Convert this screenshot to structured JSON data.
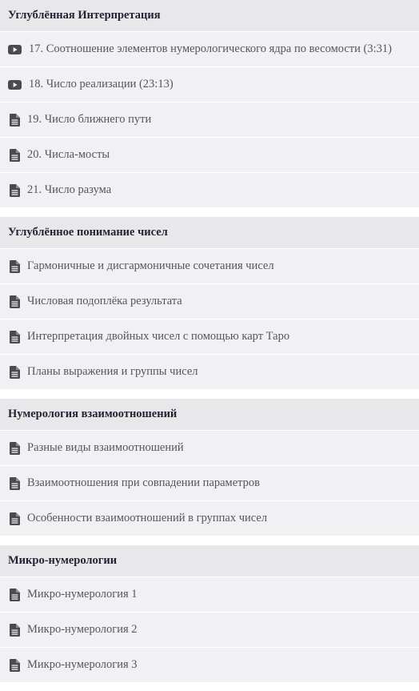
{
  "sections": [
    {
      "title": "Углублённая Интерпретация",
      "items": [
        {
          "type": "video",
          "icon": "play-video-icon",
          "label": "17. Соотношение элементов нумерологического ядра по весомости (3:31)"
        },
        {
          "type": "video",
          "icon": "play-video-icon",
          "label": "18. Число реализации (23:13)"
        },
        {
          "type": "doc",
          "icon": "document-icon",
          "label": "19. Число ближнего пути"
        },
        {
          "type": "doc",
          "icon": "document-icon",
          "label": "20. Числа-мосты"
        },
        {
          "type": "doc",
          "icon": "document-icon",
          "label": "21. Число разума"
        }
      ]
    },
    {
      "title": "Углублённое понимание чисел",
      "items": [
        {
          "type": "doc",
          "icon": "document-icon",
          "label": "Гармоничные и дисгармоничные сочетания чисел"
        },
        {
          "type": "doc",
          "icon": "document-icon",
          "label": "Числовая подоплёка результата"
        },
        {
          "type": "doc",
          "icon": "document-icon",
          "label": "Интерпретация двойных чисел с помощью карт Таро"
        },
        {
          "type": "doc",
          "icon": "document-icon",
          "label": "Планы выражения и группы чисел"
        }
      ]
    },
    {
      "title": "Нумерология взаимоотношений",
      "items": [
        {
          "type": "doc",
          "icon": "document-icon",
          "label": "Разные виды взаимоотношений"
        },
        {
          "type": "doc",
          "icon": "document-icon",
          "label": "Взаимоотношения при совпадении параметров"
        },
        {
          "type": "doc",
          "icon": "document-icon",
          "label": "Особенности взаимоотношений в группах чисел"
        }
      ]
    },
    {
      "title": "Микро-нумерологии",
      "items": [
        {
          "type": "doc",
          "icon": "document-icon",
          "label": "Микро-нумерология 1"
        },
        {
          "type": "doc",
          "icon": "document-icon",
          "label": "Микро-нумерология 2"
        },
        {
          "type": "doc",
          "icon": "document-icon",
          "label": "Микро-нумерология 3"
        }
      ]
    }
  ],
  "colors": {
    "section_header_bg": "#e8e8ea",
    "lesson_bg": "#f1f1f3",
    "header_text": "#1f2333",
    "lesson_text": "#55555c",
    "icon": "#4a4a50"
  }
}
